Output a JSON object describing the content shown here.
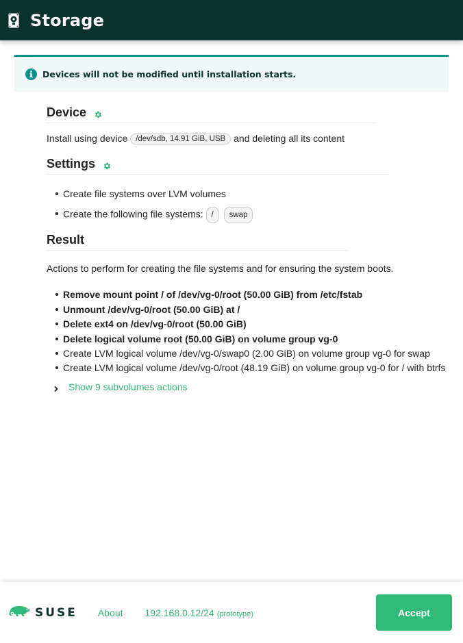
{
  "header": {
    "title": "Storage",
    "icon": "hard-drive-icon"
  },
  "alert": {
    "icon": "info-icon",
    "text": "Devices will not be modified until installation starts."
  },
  "device": {
    "title": "Device",
    "icon": "gear-icon",
    "text_before": "Install using device",
    "device_pill": "/dev/sdb, 14.91 GiB, USB",
    "text_after": "and deleting all its content"
  },
  "settings": {
    "title": "Settings",
    "icon": "gear-icon",
    "items": [
      {
        "text": "Create file systems over LVM volumes"
      },
      {
        "text": "Create the following file systems:",
        "pills": [
          "/",
          "swap"
        ]
      }
    ]
  },
  "result": {
    "title": "Result",
    "description": "Actions to perform for creating the file systems and for ensuring the system boots.",
    "actions": [
      {
        "text": "Remove mount point / of /dev/vg-0/root (50.00 GiB) from /etc/fstab",
        "destructive": true
      },
      {
        "text": "Unmount /dev/vg-0/root (50.00 GiB) at /",
        "destructive": true
      },
      {
        "text": "Delete ext4 on /dev/vg-0/root (50.00 GiB)",
        "destructive": true
      },
      {
        "text": "Delete logical volume root (50.00 GiB) on volume group vg-0",
        "destructive": true
      },
      {
        "text": "Create LVM logical volume /dev/vg-0/swap0 (2.00 GiB) on volume group vg-0 for swap",
        "destructive": false
      },
      {
        "text": "Create LVM logical volume /dev/vg-0/root (48.19 GiB) on volume group vg-0 for / with btrfs",
        "destructive": false
      }
    ],
    "expander_label": "Show 9 subvolumes actions"
  },
  "footer": {
    "logo_text": "SUSE",
    "about_label": "About",
    "ip": "192.168.0.12/24",
    "ip_note": "(prototype)",
    "accept_label": "Accept"
  },
  "colors": {
    "header_bg": "#0c322c",
    "accent": "#30ba78",
    "alert_border": "#0b918e",
    "alert_bg": "#eff8f7"
  }
}
